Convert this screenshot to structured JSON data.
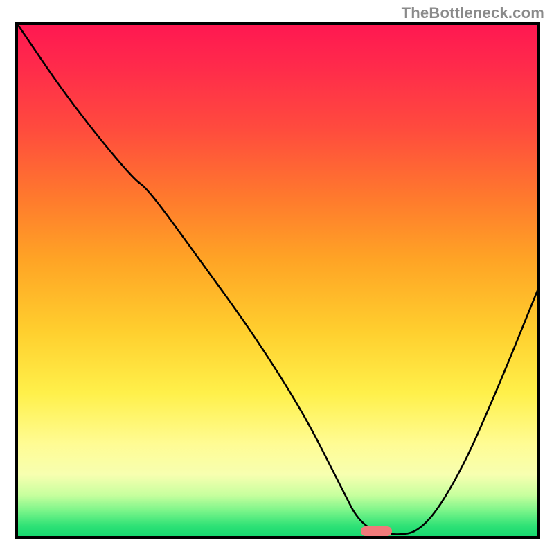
{
  "attribution": "TheBottleneck.com",
  "colors": {
    "border": "#000000",
    "curve": "#000000",
    "marker": "#f07a7a",
    "gradient_top": "#ff1851",
    "gradient_bottom": "#17d86f"
  },
  "chart_data": {
    "type": "line",
    "title": "",
    "xlabel": "",
    "ylabel": "",
    "xlim": [
      0,
      100
    ],
    "ylim": [
      0,
      100
    ],
    "series": [
      {
        "name": "bottleneck_curve",
        "x": [
          0,
          10,
          22,
          25,
          35,
          45,
          55,
          62,
          66,
          72,
          78,
          85,
          92,
          100
        ],
        "y": [
          100,
          85,
          70,
          68,
          54,
          40,
          24,
          10,
          2,
          0,
          1,
          12,
          28,
          48
        ]
      }
    ],
    "optimal_marker": {
      "x_start": 66,
      "x_end": 72,
      "y": 0
    }
  }
}
